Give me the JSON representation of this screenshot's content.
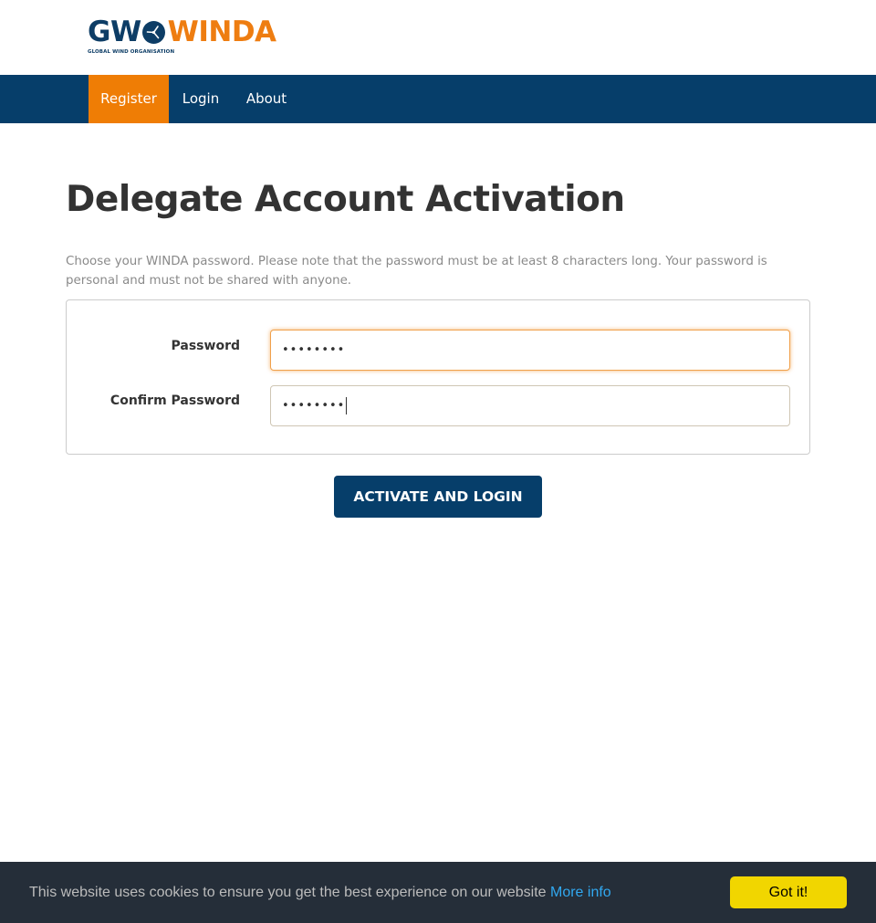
{
  "logo": {
    "gw": "GW",
    "winda": "WINDA",
    "subtitle": "GLOBAL WIND ORGANISATION"
  },
  "nav": {
    "items": [
      {
        "label": "Register",
        "active": true
      },
      {
        "label": "Login",
        "active": false
      },
      {
        "label": "About",
        "active": false
      }
    ]
  },
  "page": {
    "title": "Delegate Account Activation",
    "intro": "Choose your WINDA password. Please note that the password must be at least 8 characters long. Your password is personal and must not be shared with anyone."
  },
  "form": {
    "password_label": "Password",
    "password_value": "••••••••",
    "confirm_label": "Confirm Password",
    "confirm_value": "••••••••",
    "submit_label": "ACTIVATE AND LOGIN"
  },
  "cookie_banner": {
    "text": "This website uses cookies to ensure you get the best experience on our website",
    "link_text": "More info",
    "button_label": "Got it!"
  },
  "colors": {
    "brand_blue": "#063e6a",
    "brand_orange": "#ef7d05",
    "cookie_button": "#f1d600",
    "cookie_bg": "#252e39"
  }
}
